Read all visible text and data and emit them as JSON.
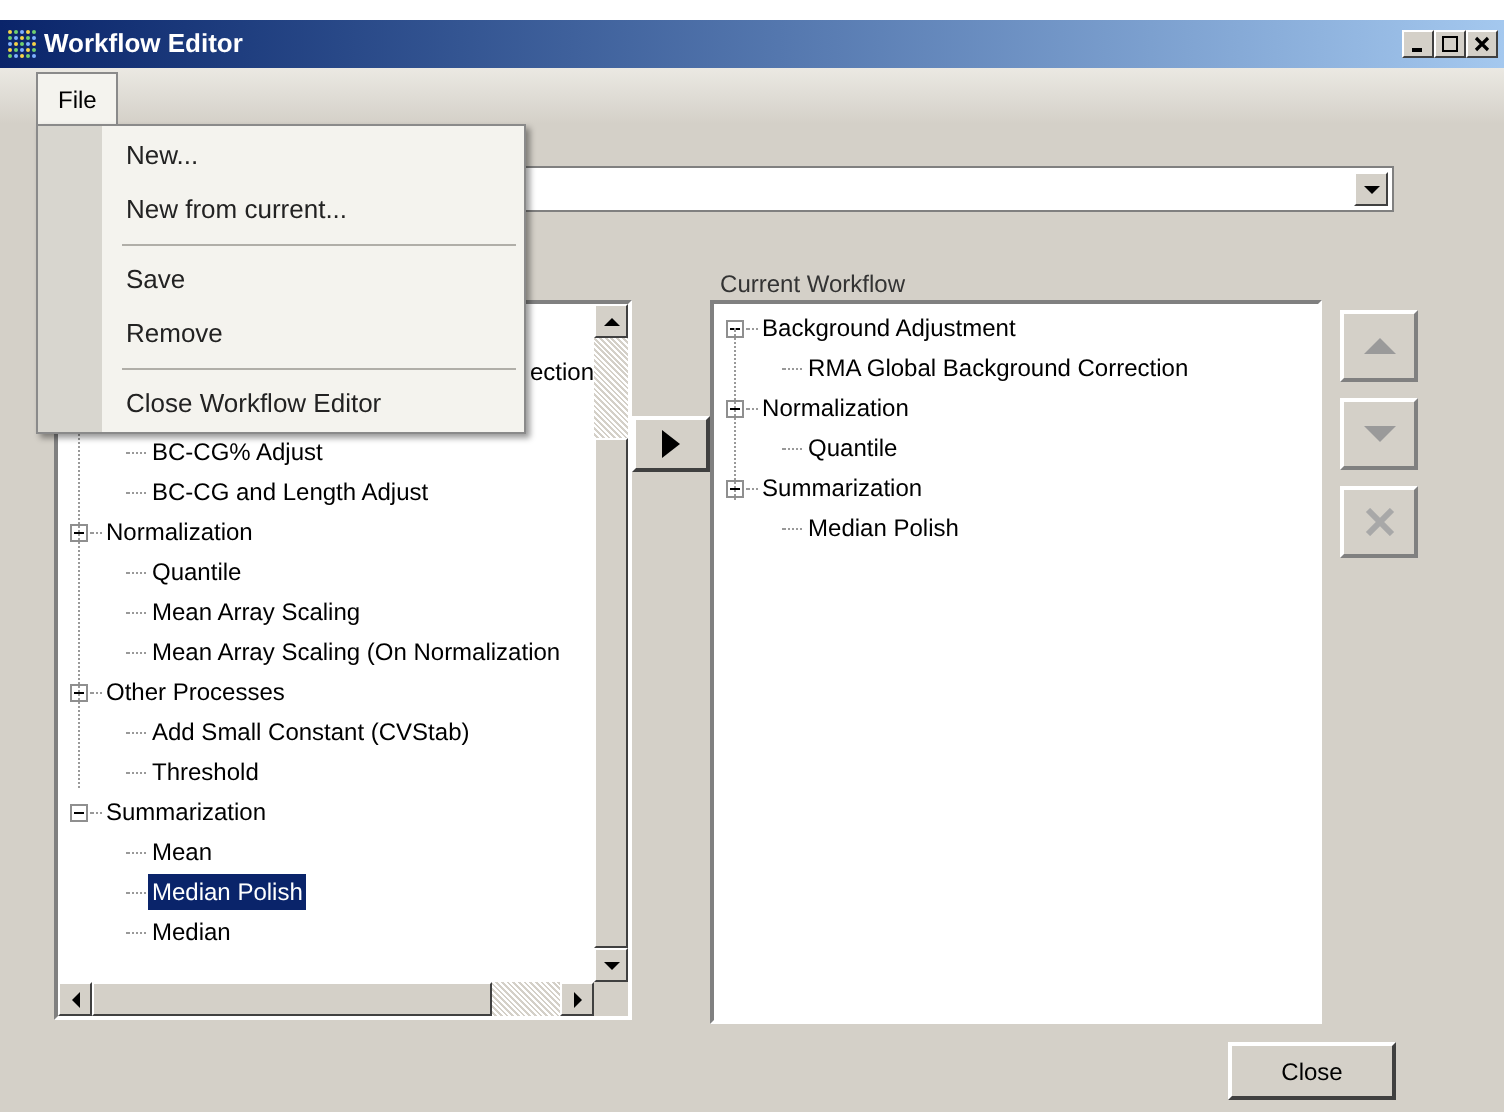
{
  "window": {
    "title": "Workflow Editor"
  },
  "menu_bar": [
    {
      "label": "File",
      "selected": true
    }
  ],
  "file_menu": [
    {
      "kind": "item",
      "label": "New..."
    },
    {
      "kind": "item",
      "label": "New from current..."
    },
    {
      "kind": "separator"
    },
    {
      "kind": "item",
      "label": "Save"
    },
    {
      "kind": "item",
      "label": "Remove"
    },
    {
      "kind": "separator"
    },
    {
      "kind": "item",
      "label": "Close Workflow Editor"
    }
  ],
  "available_tree": {
    "partial_rows": [
      {
        "label": "ection"
      },
      {
        "label": "BC-CG% Adjust"
      },
      {
        "label": "BC-CG and Length Adjust"
      }
    ],
    "groups": [
      {
        "label": "Normalization",
        "expanded": true,
        "children": [
          {
            "label": "Quantile",
            "selected": false
          },
          {
            "label": "Mean Array Scaling",
            "selected": false
          },
          {
            "label": "Mean Array Scaling (On Normalization",
            "selected": false
          }
        ]
      },
      {
        "label": "Other Processes",
        "expanded": true,
        "children": [
          {
            "label": "Add Small Constant (CVStab)",
            "selected": false
          },
          {
            "label": "Threshold",
            "selected": false
          }
        ]
      },
      {
        "label": "Summarization",
        "expanded": true,
        "children": [
          {
            "label": "Mean",
            "selected": false
          },
          {
            "label": "Median Polish",
            "selected": true
          },
          {
            "label": "Median",
            "selected": false
          }
        ]
      }
    ]
  },
  "current_workflow": {
    "label": "Current Workflow",
    "groups": [
      {
        "label": "Background Adjustment",
        "expanded": true,
        "children": [
          {
            "label": "RMA Global Background Correction",
            "selected": false
          }
        ]
      },
      {
        "label": "Normalization",
        "expanded": true,
        "children": [
          {
            "label": "Quantile",
            "selected": false
          }
        ]
      },
      {
        "label": "Summarization",
        "expanded": true,
        "children": [
          {
            "label": "Median Polish",
            "selected": false
          }
        ]
      }
    ]
  },
  "buttons": [
    {
      "label": "Close"
    }
  ]
}
